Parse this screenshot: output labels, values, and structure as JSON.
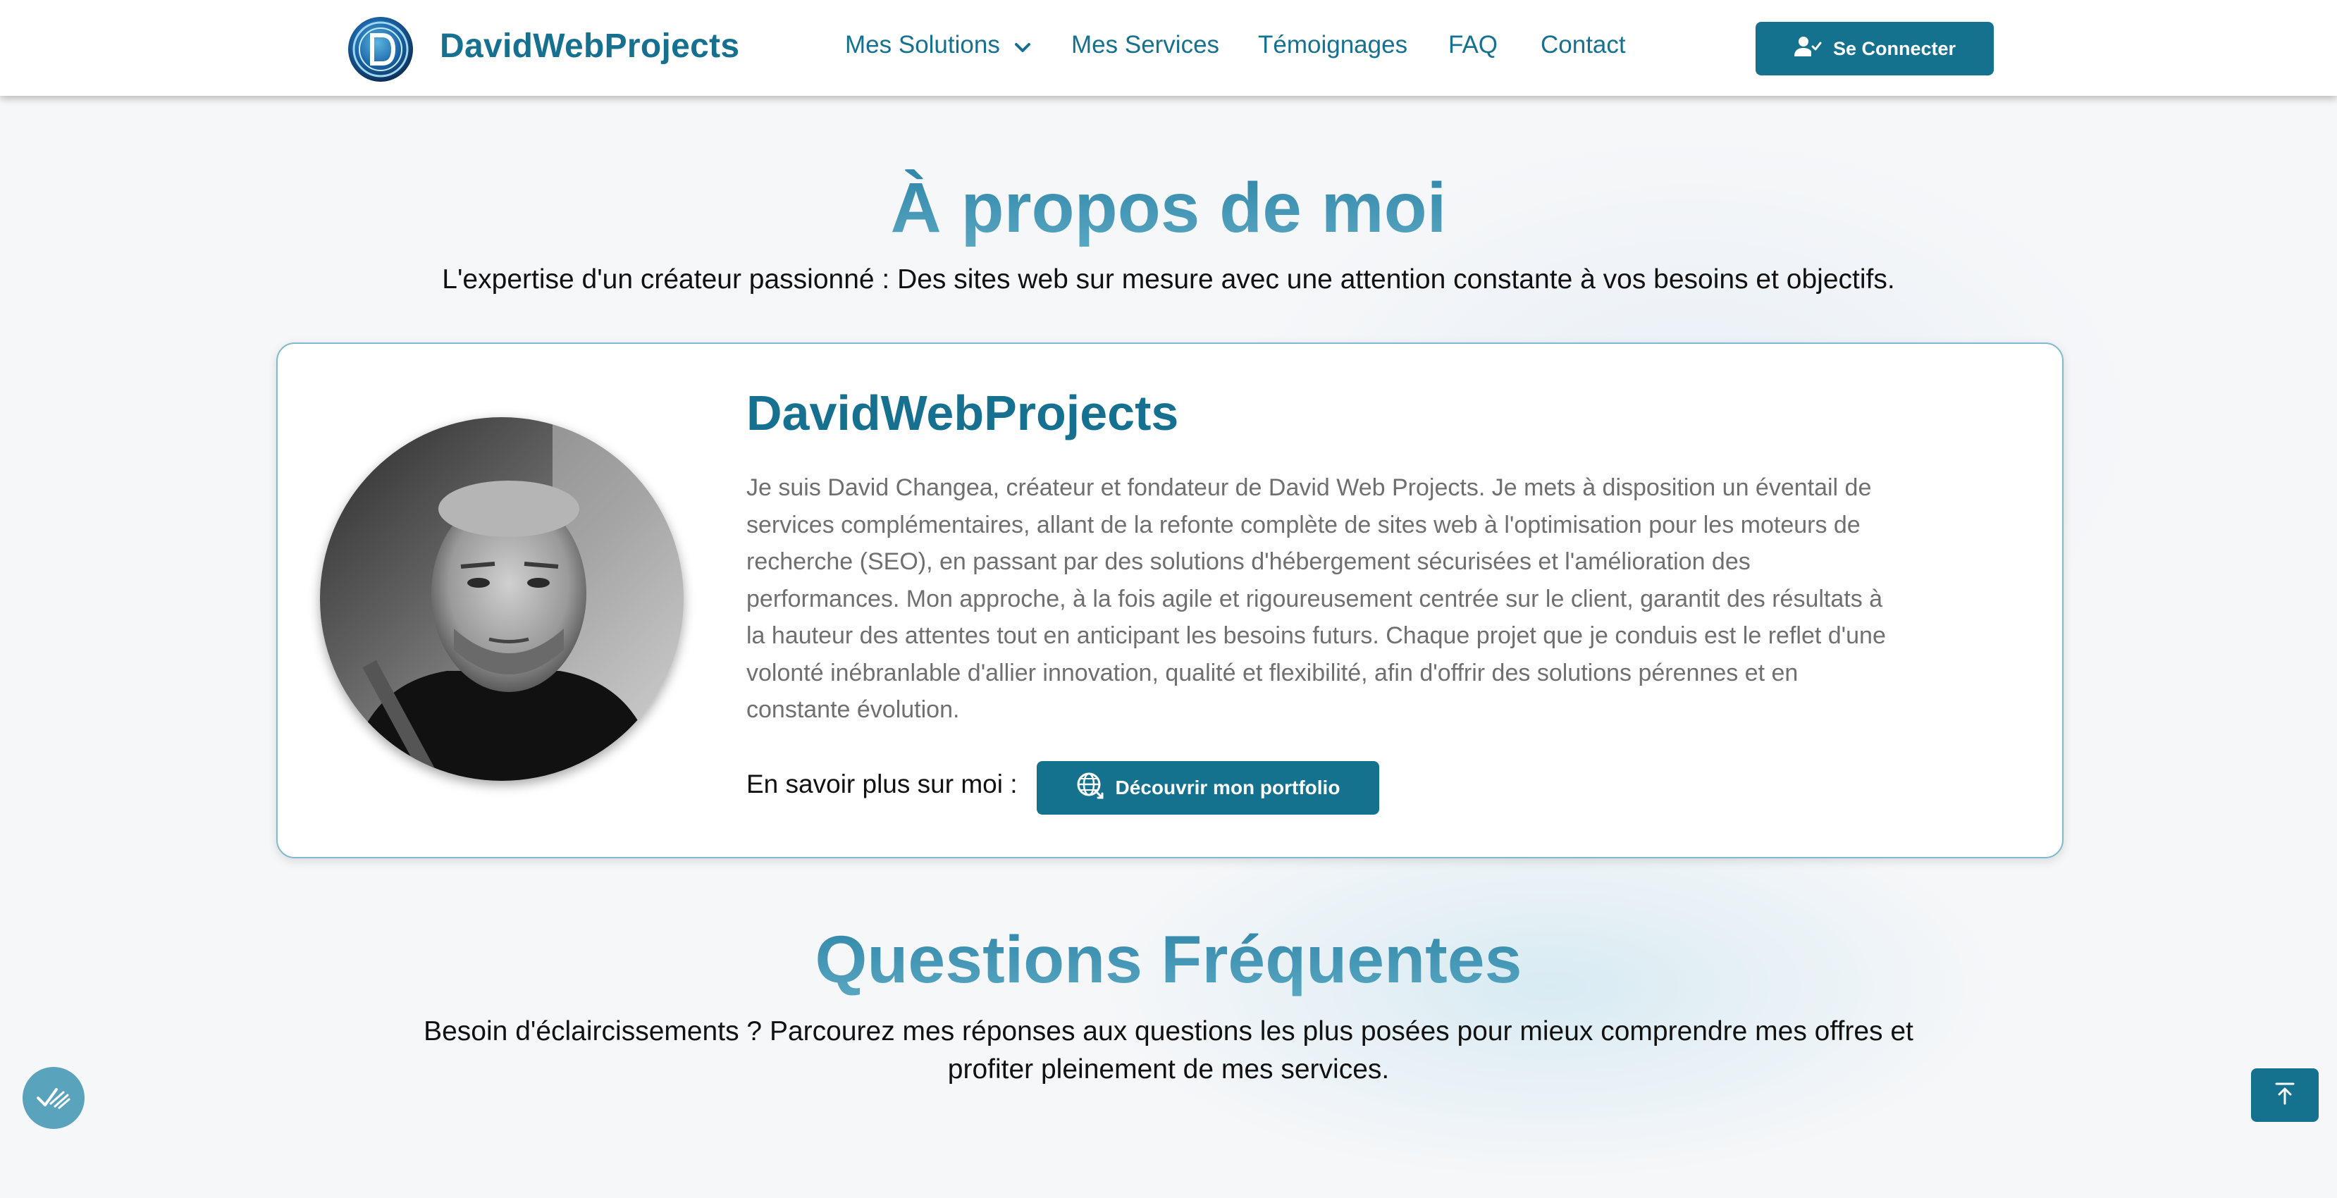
{
  "header": {
    "brand": "DavidWebProjects",
    "nav": [
      {
        "label": "Mes Solutions",
        "has_dropdown": true
      },
      {
        "label": "Mes Services"
      },
      {
        "label": "Témoignages"
      },
      {
        "label": "FAQ"
      },
      {
        "label": "Contact"
      }
    ],
    "login_label": "Se Connecter",
    "login_icon": "user-check-icon"
  },
  "about": {
    "title": "À propos de moi",
    "subtitle": "L'expertise d'un créateur passionné : Des sites web sur mesure avec une attention constante à vos besoins et objectifs.",
    "card": {
      "name": "DavidWebProjects",
      "text": "Je suis David Changea, créateur et fondateur de David Web Projects. Je mets à disposition un éventail de services complémentaires, allant de la refonte complète de sites web à l'optimisation pour les moteurs de recherche (SEO), en passant par des solutions d'hébergement sécurisées et l'amélioration des performances. Mon approche, à la fois agile et rigoureusement centrée sur le client, garantit des résultats à la hauteur des attentes tout en anticipant les besoins futurs. Chaque projet que je conduis est le reflet d'une volonté inébranlable d'allier innovation, qualité et flexibilité, afin d'offrir des solutions pérennes et en constante évolution.",
      "more_label": "En savoir plus sur moi :",
      "portfolio_label": "Découvrir mon portfolio",
      "portfolio_icon": "globe-icon"
    }
  },
  "faq": {
    "title": "Questions Fréquentes",
    "subtitle": "Besoin d'éclaircissements ? Parcourez mes réponses aux questions les plus posées pour mieux comprendre mes offres et profiter pleinement de mes services."
  },
  "floating": {
    "left_icon": "accessibility-check-icon",
    "right_icon": "arrow-up-to-top-icon"
  },
  "colors": {
    "primary": "#15728f",
    "title_gradient_start": "#2f86a8",
    "title_gradient_end": "#5aa7c2",
    "background": "#f6f7f9"
  }
}
